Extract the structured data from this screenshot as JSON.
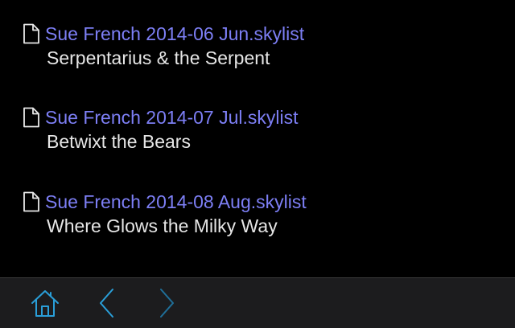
{
  "colors": {
    "background": "#000000",
    "link": "#7d7ff5",
    "description": "#e6e6e6",
    "icon": "#e8e8e8",
    "toolbar_bg": "#1c1c1e",
    "toolbar_accent": "#2a9fd9",
    "toolbar_disabled": "#1f6f99"
  },
  "entries": [
    {
      "link": "Sue French 2014-06 Jun.skylist",
      "description": "Serpentarius & the Serpent",
      "icon": "document-icon"
    },
    {
      "link": "Sue French 2014-07 Jul.skylist",
      "description": "Betwixt the Bears",
      "icon": "document-icon"
    },
    {
      "link": "Sue French 2014-08 Aug.skylist",
      "description": "Where Glows the Milky Way",
      "icon": "document-icon"
    }
  ],
  "toolbar": {
    "buttons": [
      {
        "icon": "home-icon"
      },
      {
        "icon": "chevron-left-icon"
      },
      {
        "icon": "chevron-right-icon"
      }
    ]
  }
}
